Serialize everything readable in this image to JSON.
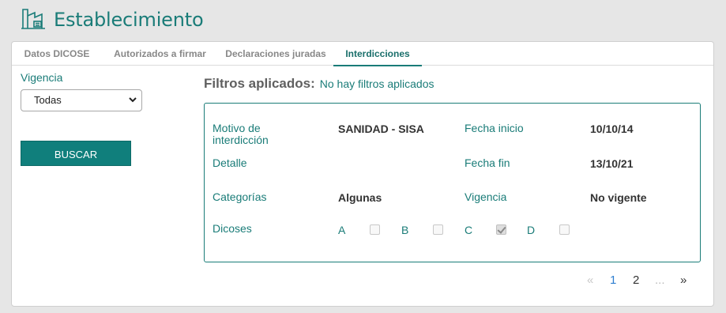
{
  "header": {
    "title": "Establecimiento",
    "icon": "building-icon"
  },
  "tabs": [
    {
      "label": "Datos DICOSE",
      "active": false
    },
    {
      "label": "Autorizados a firmar",
      "active": false
    },
    {
      "label": "Declaraciones juradas",
      "active": false
    },
    {
      "label": "Interdicciones",
      "active": true
    }
  ],
  "sidebar": {
    "vigencia_label": "Vigencia",
    "vigencia_value": "Todas",
    "search_button": "BUSCAR"
  },
  "filters": {
    "label": "Filtros aplicados:",
    "value": "No hay filtros aplicados"
  },
  "interdiction": {
    "motivo_label": "Motivo de interdicción",
    "motivo_value": "SANIDAD - SISA",
    "fecha_inicio_label": "Fecha inicio",
    "fecha_inicio_value": "10/10/14",
    "detalle_label": "Detalle",
    "detalle_value": "",
    "fecha_fin_label": "Fecha fin",
    "fecha_fin_value": "13/10/21",
    "categorias_label": "Categorías",
    "categorias_value": "Algunas",
    "vigencia_label": "Vigencia",
    "vigencia_value": "No vigente",
    "dicoses_label": "Dicoses",
    "dicoses": [
      {
        "letter": "A",
        "checked": false
      },
      {
        "letter": "B",
        "checked": false
      },
      {
        "letter": "C",
        "checked": true
      },
      {
        "letter": "D",
        "checked": false
      }
    ]
  },
  "pagination": {
    "prev": "«",
    "pages": [
      "1",
      "2"
    ],
    "current": "1",
    "ellipsis": "...",
    "next": "»"
  },
  "colors": {
    "accent": "#1a7c78",
    "button": "#107f7c",
    "active_page": "#2f7fd0"
  }
}
